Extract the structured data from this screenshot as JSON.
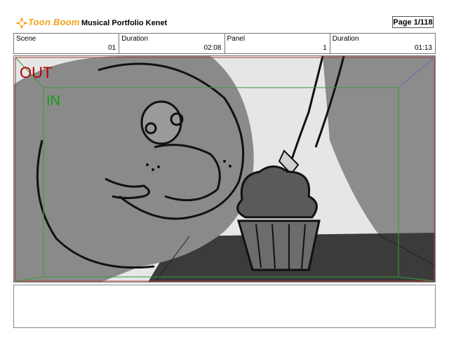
{
  "header": {
    "logo_text": "Toon Boom",
    "title": "Musical Portfolio Kenet",
    "page_label": "Page  1/118"
  },
  "info": {
    "scene_label": "Scene",
    "scene_value": "01",
    "duration1_label": "Duration",
    "duration1_value": "02:08",
    "panel_label": "Panel",
    "panel_value": "1",
    "duration2_label": "Duration",
    "duration2_value": "01:13"
  },
  "frame": {
    "out_label": "OUT",
    "in_label": "IN"
  },
  "colors": {
    "logo_orange": "#f2a21b",
    "out_red": "#b10000",
    "in_green": "#10a010"
  }
}
